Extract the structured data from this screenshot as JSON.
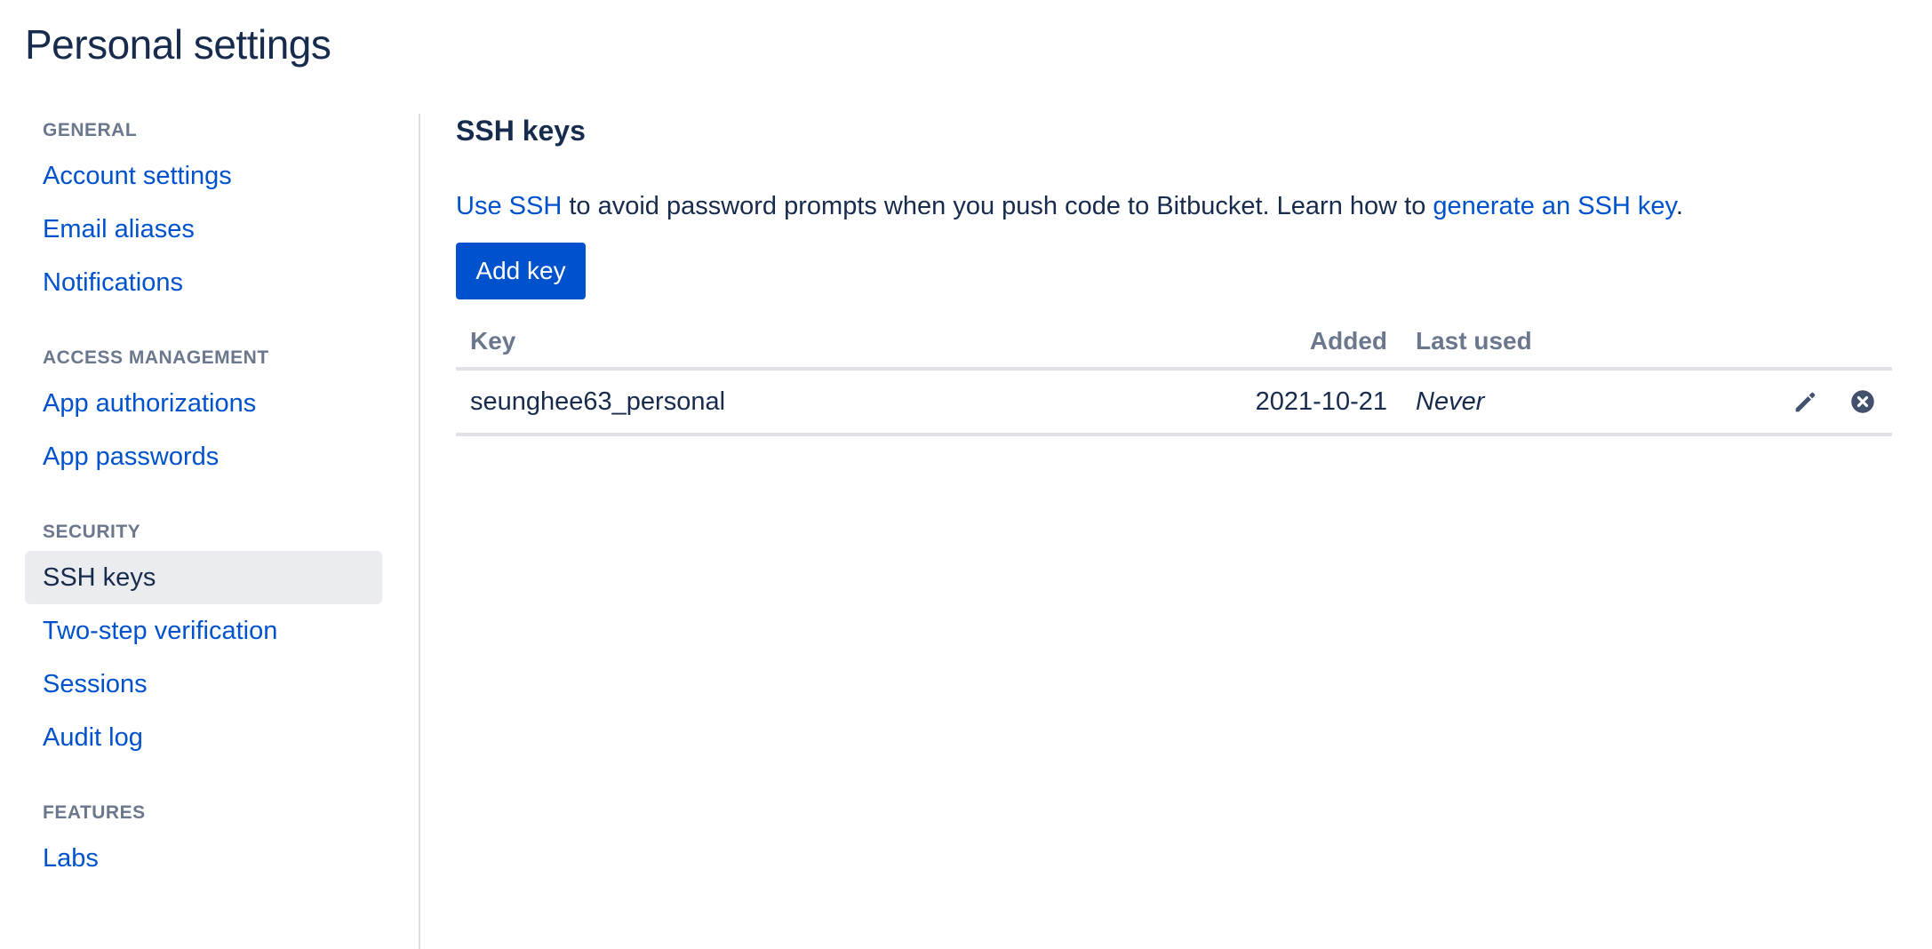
{
  "page": {
    "title": "Personal settings"
  },
  "sidebar": {
    "sections": [
      {
        "heading": "GENERAL",
        "items": [
          {
            "label": "Account settings",
            "active": false
          },
          {
            "label": "Email aliases",
            "active": false
          },
          {
            "label": "Notifications",
            "active": false
          }
        ]
      },
      {
        "heading": "ACCESS MANAGEMENT",
        "items": [
          {
            "label": "App authorizations",
            "active": false
          },
          {
            "label": "App passwords",
            "active": false
          }
        ]
      },
      {
        "heading": "SECURITY",
        "items": [
          {
            "label": "SSH keys",
            "active": true
          },
          {
            "label": "Two-step verification",
            "active": false
          },
          {
            "label": "Sessions",
            "active": false
          },
          {
            "label": "Audit log",
            "active": false
          }
        ]
      },
      {
        "heading": "FEATURES",
        "items": [
          {
            "label": "Labs",
            "active": false
          }
        ]
      }
    ]
  },
  "main": {
    "title": "SSH keys",
    "description": {
      "link1": "Use SSH",
      "text1": " to avoid password prompts when you push code to Bitbucket. Learn how to ",
      "link2": "generate an SSH key",
      "text2": "."
    },
    "add_button": "Add key",
    "table": {
      "headers": {
        "key": "Key",
        "added": "Added",
        "last_used": "Last used"
      },
      "rows": [
        {
          "key": "seunghee63_personal",
          "added": "2021-10-21",
          "last_used": "Never",
          "actions": [
            "pencil-icon",
            "remove-circle-icon"
          ]
        }
      ]
    }
  },
  "colors": {
    "link": "#0052cc",
    "primary_button": "#0052cc",
    "text": "#172b4d",
    "muted": "#6b778c",
    "active_nav_bg": "#ebecf0",
    "border": "#dfe1e6"
  }
}
